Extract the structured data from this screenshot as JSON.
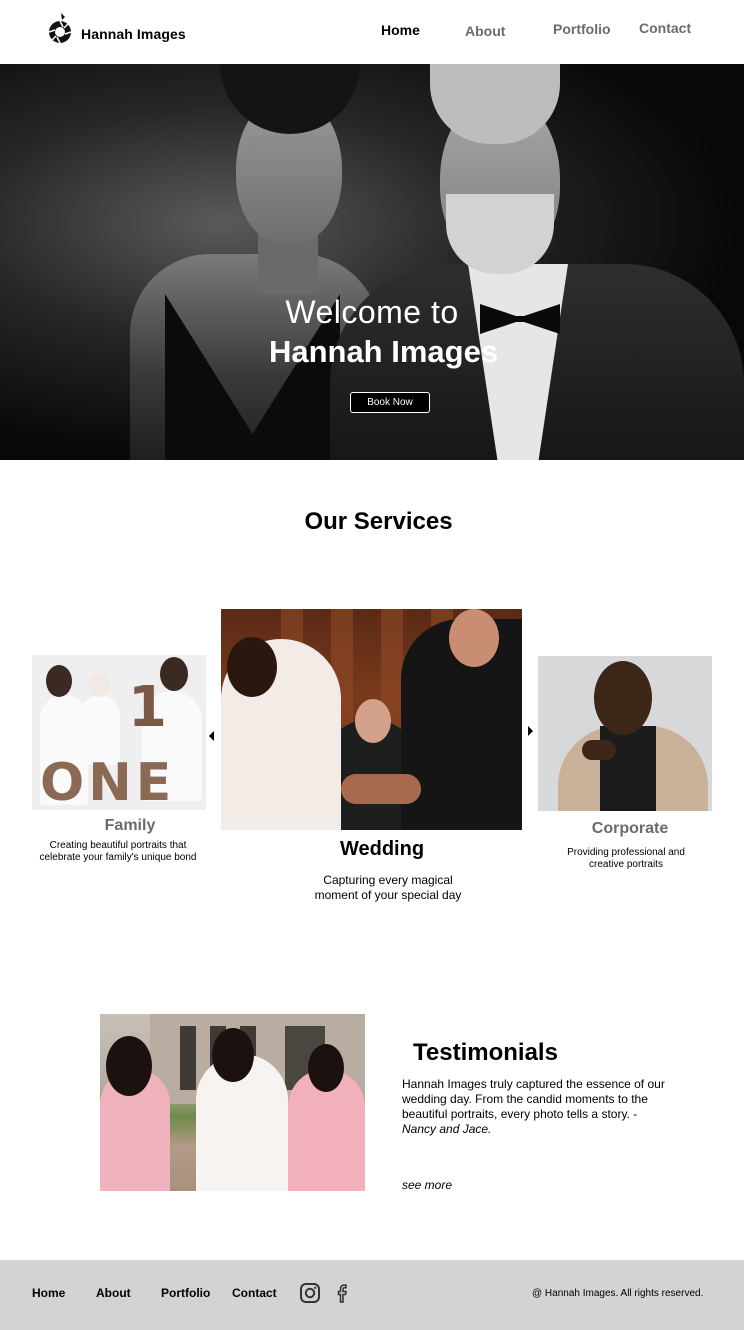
{
  "header": {
    "brand": "Hannah Images",
    "nav": {
      "home": "Home",
      "about": "About",
      "portfolio": "Portfolio",
      "contact": "Contact"
    },
    "logo_icon": "camera-aperture-icon"
  },
  "hero": {
    "title_line1": "Welcome to",
    "title_line2": "Hannah Images",
    "cta": "Book Now"
  },
  "services": {
    "title": "Our Services",
    "items": [
      {
        "name": "Family",
        "description": "Creating beautiful portraits that celebrate your family's unique bond"
      },
      {
        "name": "Wedding",
        "description": "Capturing every magical moment of your special day"
      },
      {
        "name": "Corporate",
        "description": "Providing professional and creative portraits"
      }
    ],
    "family_image_text": "ONE",
    "family_image_numeral": "1",
    "prev_icon": "caret-left-icon",
    "next_icon": "caret-right-icon"
  },
  "testimonials": {
    "title": "Testimonials",
    "quote": "Hannah Images truly captured the essence of our wedding day. From the candid moments to the beautiful portraits, every photo tells a story. - ",
    "author": "Nancy and Jace.",
    "see_more": "see more"
  },
  "footer": {
    "nav": {
      "home": "Home",
      "about": "About",
      "portfolio": "Portfolio",
      "contact": "Contact"
    },
    "icons": [
      "instagram-icon",
      "facebook-icon"
    ],
    "copyright": "@ Hannah Images. All rights reserved."
  },
  "colors": {
    "nav_active": "#000000",
    "nav_inactive": "#6b6b6b",
    "footer_bg": "#d3d3d3",
    "hero_bg": "#111111"
  }
}
